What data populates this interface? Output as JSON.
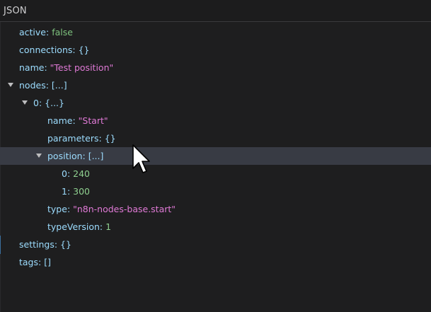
{
  "header": {
    "title": "JSON"
  },
  "tree": {
    "active": {
      "key": "active",
      "value": "false"
    },
    "connections": {
      "key": "connections",
      "value": "{}"
    },
    "name": {
      "key": "name",
      "value": "\"Test position\""
    },
    "nodes": {
      "key": "nodes",
      "value": "[...]"
    },
    "node0": {
      "key": "0",
      "value": "{...}"
    },
    "node0_name": {
      "key": "name",
      "value": "\"Start\""
    },
    "node0_parameters": {
      "key": "parameters",
      "value": "{}"
    },
    "node0_position": {
      "key": "position",
      "value": "[...]"
    },
    "position0": {
      "key": "0",
      "value": "240"
    },
    "position1": {
      "key": "1",
      "value": "300"
    },
    "node0_type": {
      "key": "type",
      "value": "\"n8n-nodes-base.start\""
    },
    "node0_typeVersion": {
      "key": "typeVersion",
      "value": "1"
    },
    "settings": {
      "key": "settings",
      "value": "{}"
    },
    "tags": {
      "key": "tags",
      "value": "[]"
    }
  },
  "colors": {
    "key": "#9cdcfe",
    "boolean": "#7ec37e",
    "number": "#8fd08f",
    "string": "#e07ad6",
    "selection": "#383b44"
  },
  "icons": {
    "expanded": "chevron-down-icon",
    "pointer": "mouse-pointer-icon"
  }
}
